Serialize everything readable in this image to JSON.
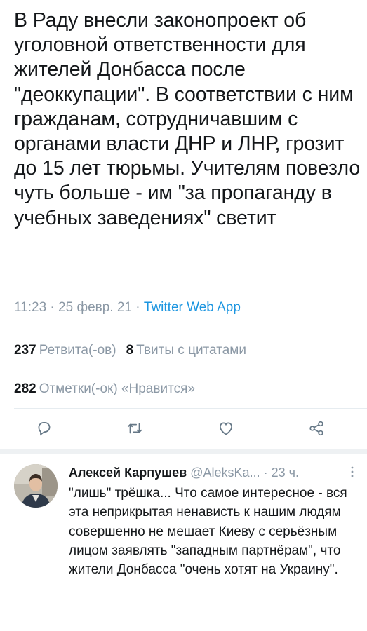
{
  "tweet": {
    "text": "В Раду внесли законопроект об уголовной ответственности для жителей Донбасса после \"деоккупации\". В соответствии с ним гражданам, сотрудничавшим с органами власти ДНР и ЛНР, грозит до 15 лет тюрьмы. Учителям повезло чуть больше - им \"за пропаганду в учебных заведениях\" светит",
    "time": "11:23",
    "date": "25 февр. 21",
    "source": "Twitter Web App",
    "sep": " · "
  },
  "stats": {
    "retweets_count": "237",
    "retweets_label": "Ретвита(-ов)",
    "quotes_count": "8",
    "quotes_label": "Твиты с цитатами",
    "likes_count": "282",
    "likes_label": "Отметки(-ок) «Нравится»"
  },
  "actions": [
    "reply-icon",
    "retweet-icon",
    "like-icon",
    "share-icon"
  ],
  "reply": {
    "name": "Алексей Карпушев",
    "handle": "@AleksKa...",
    "time": "· 23 ч.",
    "text": "\"лишь\" трёшка... Что самое интересное - вся эта неприкрытая ненависть к нашим людям совершенно не мешает Киеву с серьёзным лицом заявлять \"западным партнёрам\", что жители Донбасса \"очень хотят на Украину\"."
  },
  "colors": {
    "text": "#14171a",
    "muted": "#8b98a5",
    "link": "#1b95e0"
  }
}
